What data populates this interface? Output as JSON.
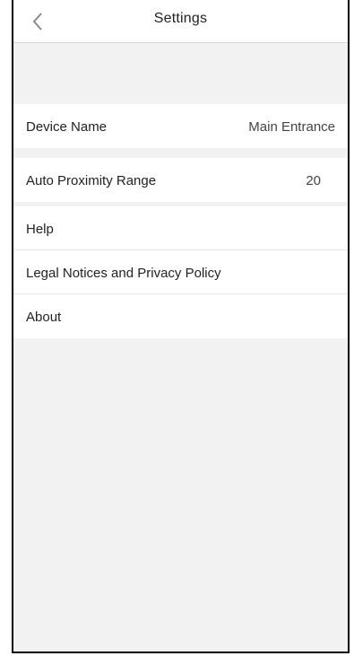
{
  "header": {
    "title": "Settings",
    "back_icon": "chevron-left-icon"
  },
  "settings": {
    "device_name": {
      "label": "Device Name",
      "value": "Main Entrance"
    },
    "auto_proximity_range": {
      "label": "Auto Proximity Range",
      "value": "20"
    },
    "help": {
      "label": "Help"
    },
    "legal": {
      "label": "Legal Notices and Privacy Policy"
    },
    "about": {
      "label": "About"
    }
  },
  "colors": {
    "background": "#f2f2f2",
    "row_background": "#ffffff",
    "text": "#222222"
  }
}
